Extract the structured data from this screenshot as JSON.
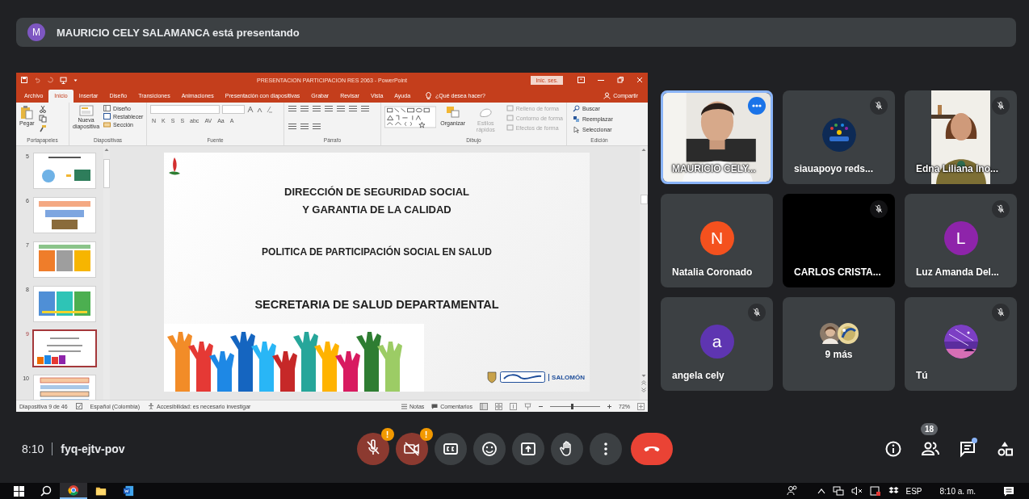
{
  "presenter_banner": {
    "avatar": "M",
    "text": "MAURICIO CELY SALAMANCA está presentando"
  },
  "powerpoint": {
    "title": "PRESENTACION PARTICIPACION RES 2063  -  PowerPoint",
    "sign_in": "Inic. ses.",
    "tabs": [
      {
        "label": "Archivo",
        "selected": false
      },
      {
        "label": "Inicio",
        "selected": true
      },
      {
        "label": "Insertar",
        "selected": false
      },
      {
        "label": "Diseño",
        "selected": false
      },
      {
        "label": "Transiciones",
        "selected": false
      },
      {
        "label": "Animaciones",
        "selected": false
      },
      {
        "label": "Presentación con diapositivas",
        "selected": false
      },
      {
        "label": "Grabar",
        "selected": false
      },
      {
        "label": "Revisar",
        "selected": false
      },
      {
        "label": "Vista",
        "selected": false
      },
      {
        "label": "Ayuda",
        "selected": false
      }
    ],
    "tell_me": "¿Qué desea hacer?",
    "share": "Compartir",
    "ribbon": {
      "clipboard": {
        "label": "Portapapeles",
        "paste": "Pegar"
      },
      "slides": {
        "label": "Diapositivas",
        "new_slide": "Nueva diapositiva",
        "layout": "Diseño",
        "reset": "Restablecer",
        "section": "Sección"
      },
      "font": {
        "label": "Fuente",
        "format_buttons": [
          "N",
          "K",
          "S",
          "S",
          "abc",
          "AV",
          "Aa",
          "A"
        ]
      },
      "paragraph": {
        "label": "Párrafo"
      },
      "drawing": {
        "label": "Dibujo",
        "buttons": [
          {
            "label": "Organizar",
            "disabled": false
          },
          {
            "label": "Estilos rápidos",
            "disabled": true
          }
        ],
        "shape_format": [
          {
            "label": "Relleno de forma",
            "disabled": true
          },
          {
            "label": "Contorno de forma",
            "disabled": true
          },
          {
            "label": "Efectos de forma",
            "disabled": true
          }
        ]
      },
      "editing": {
        "label": "Edición",
        "buttons": [
          "Buscar",
          "Reemplazar",
          "Seleccionar"
        ]
      }
    },
    "thumbnails": [
      {
        "number": "5",
        "selected": false
      },
      {
        "number": "6",
        "selected": false
      },
      {
        "number": "7",
        "selected": false
      },
      {
        "number": "8",
        "selected": false
      },
      {
        "number": "9",
        "selected": true
      },
      {
        "number": "10",
        "selected": false
      }
    ],
    "slide": {
      "title_lines": [
        "DIRECCIÓN DE SEGURIDAD SOCIAL",
        "Y GARANTIA DE LA CALIDAD"
      ],
      "subtitle": "POLITICA DE PARTICIPACIÓN SOCIAL EN SALUD",
      "department": "SECRETARIA DE SALUD DEPARTAMENTAL",
      "logo_text": "SALOMÓN"
    },
    "status_bar": {
      "slide_count": "Diapositiva 9 de 46",
      "language": "Español (Colombia)",
      "accessibility": "Accesibilidad: es necesario investigar",
      "notes": "Notas",
      "comments": "Comentarios",
      "zoom": {
        "level": 0.45
      },
      "zoom_percent": "72%"
    }
  },
  "participants": [
    {
      "name": "MAURICIO CELY...",
      "kind": "video",
      "muted": false,
      "active": true
    },
    {
      "name": "siauapoyo reds...",
      "muted": true,
      "active": false
    },
    {
      "name": "Edna Liliana Ino...",
      "kind": "portrait-video",
      "muted": true,
      "active": false
    },
    {
      "name": "Natalia Coronado",
      "kind": "avatar",
      "letter": "N",
      "color": "#f4511e",
      "muted": false,
      "active": false
    },
    {
      "name": "CARLOS CRISTA...",
      "kind": "blank",
      "muted": true,
      "active": false
    },
    {
      "name": "Luz Amanda Del...",
      "kind": "avatar",
      "letter": "L",
      "color": "#8e24aa",
      "muted": true,
      "active": false
    },
    {
      "name": "angela cely",
      "kind": "avatar",
      "letter": "a",
      "color": "#5e35b1",
      "muted": true,
      "active": false
    },
    {
      "name": "9 más",
      "kind": "overflow",
      "muted": false,
      "active": false
    },
    {
      "name": "Tú",
      "muted": true,
      "active": false
    }
  ],
  "meeting_bar": {
    "time": "8:10",
    "code": "fyq-ejtv-pov",
    "controls": [
      {
        "kind": "mic",
        "off": true,
        "alert": "!"
      },
      {
        "kind": "camera",
        "off": true,
        "alert": "!"
      },
      {
        "kind": "captions",
        "off": false
      },
      {
        "kind": "emoji",
        "off": false
      },
      {
        "kind": "present",
        "off": false
      },
      {
        "kind": "hand",
        "off": false
      },
      {
        "kind": "more",
        "off": false
      },
      {
        "kind": "end-call",
        "off": false
      }
    ],
    "people_count": "18",
    "chat_unread": true
  },
  "taskbar": {
    "apps": [
      {
        "kind": "browser",
        "selected": true
      },
      {
        "kind": "folder",
        "selected": false
      },
      {
        "kind": "word",
        "selected": false
      }
    ],
    "language": "ESP",
    "time": "8:10 a. m."
  }
}
